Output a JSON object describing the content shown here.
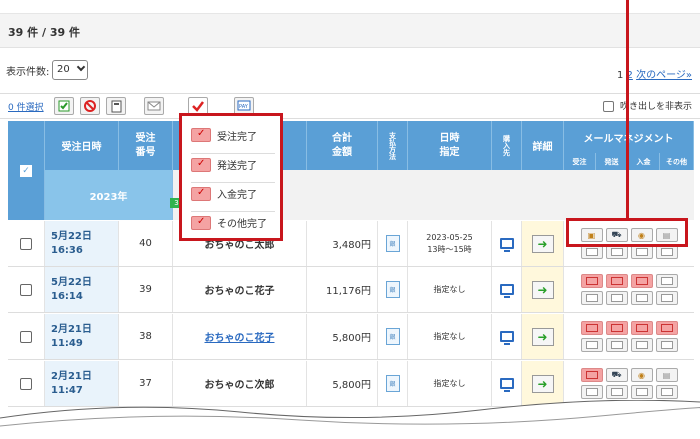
{
  "header": {
    "count_label": "39 件 / 39 件"
  },
  "controls": {
    "per_page_label": "表示件数:",
    "per_page_value": "20",
    "pager_current": "1",
    "pager_next_page": "2",
    "pager_next_label": "次のページ»"
  },
  "bulk": {
    "select_label": "0 件選択",
    "hide_label": "吹き出しを非表示"
  },
  "table": {
    "headers": {
      "date": "受注日時",
      "number": "受注\n番号",
      "total": "合計\n金額",
      "payment": "支払方法",
      "date_spec": "日時\n指定",
      "purchase_source": "購入先",
      "detail": "詳細",
      "mail": "メールマネジメント",
      "mail_sub": [
        "受注",
        "発送",
        "入金",
        "その他"
      ]
    },
    "year_group": "2023年",
    "rows": [
      {
        "date": "5月22日\n16:36",
        "number": "40",
        "name": "おちゃのこ太郎",
        "total": "3,480円",
        "pay": "銀",
        "date_spec": "2023-05-25\n13時～15時"
      },
      {
        "date": "5月22日\n16:14",
        "number": "39",
        "name": "おちゃのこ花子",
        "total": "11,176円",
        "pay": "銀",
        "date_spec": "指定なし"
      },
      {
        "date": "2月21日\n11:49",
        "number": "38",
        "name": "おちゃのこ花子",
        "total": "5,800円",
        "pay": "銀",
        "date_spec": "指定なし",
        "badge": "3"
      },
      {
        "date": "2月21日\n11:47",
        "number": "37",
        "name": "おちゃのこ次郎",
        "total": "5,800円",
        "pay": "銀",
        "date_spec": "指定なし"
      }
    ]
  },
  "popup": {
    "items": [
      "受注完了",
      "発送完了",
      "入金完了",
      "その他完了"
    ]
  },
  "colors": {
    "header_blue": "#5a9fd6",
    "highlight_red": "#c8161d",
    "active_red": "#f4a3a3"
  }
}
